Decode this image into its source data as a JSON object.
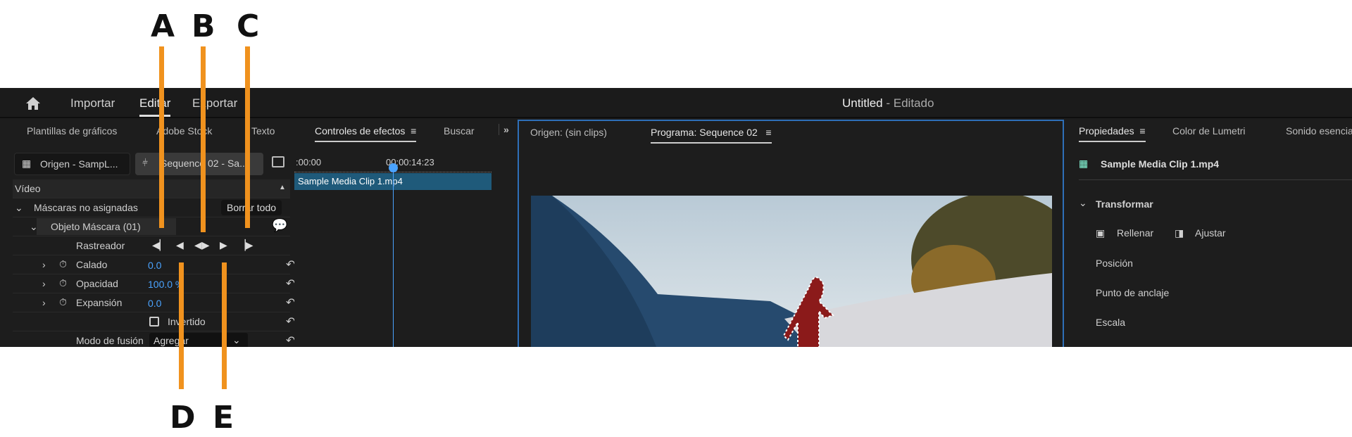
{
  "callouts": [
    "A",
    "B",
    "C",
    "D",
    "E"
  ],
  "topbar": {
    "nav": [
      "Importar",
      "Editar",
      "Exportar"
    ],
    "active": "Editar",
    "title": "Untitled",
    "title_suffix": " - Editado"
  },
  "left_tabs": [
    "Plantillas de gráficos",
    "Adobe Stock",
    "Texto",
    "Controles de efectos",
    "Buscar"
  ],
  "left_tabs_more": "»",
  "effect_controls": {
    "source_tab": "Origen - SampL...",
    "sequence_tab": "Sequence 02 - Sa...",
    "section": "Vídeo",
    "unassigned_masks": "Máscaras no asignadas",
    "clear_all": "Borrar todo",
    "mask_object": "Objeto Máscara (01)",
    "tracker": "Rastreador",
    "properties": [
      {
        "label": "Calado",
        "value": "0.0"
      },
      {
        "label": "Opacidad",
        "value": "100.0 %"
      },
      {
        "label": "Expansión",
        "value": "0.0"
      }
    ],
    "inverted": "Invertido",
    "blend_mode_label": "Modo de fusión",
    "blend_mode_value": "Agregar"
  },
  "timeline": {
    "start": ":00:00",
    "playhead": "00:00:14:23",
    "clip": "Sample Media Clip 1.mp4"
  },
  "monitor": {
    "tabs": [
      "Origen: (sin clips)",
      "Programa: Sequence 02"
    ]
  },
  "right_panel": {
    "tabs": [
      "Propiedades",
      "Color de Lumetri",
      "Sonido esencial"
    ],
    "clip": "Sample Media Clip 1.mp4",
    "section": "Transformar",
    "fill": "Rellenar",
    "fit": "Ajustar",
    "props": [
      "Posición",
      "Punto de anclaje",
      "Escala"
    ]
  },
  "colors": {
    "accent": "#4aa3ff",
    "callout": "#f0921e",
    "clip": "#1f5a7a"
  }
}
